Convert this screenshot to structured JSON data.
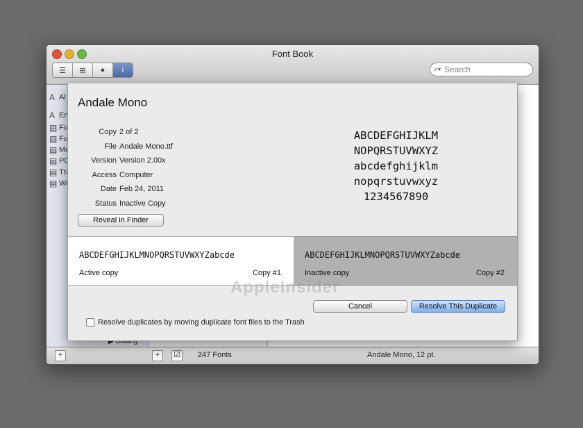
{
  "window": {
    "title": "Font Book"
  },
  "toolbar": {
    "search_placeholder": "Search"
  },
  "sidebar": {
    "items": [
      {
        "glyph": "A",
        "label": "Al"
      },
      {
        "glyph": "A",
        "label": "En"
      },
      {
        "glyph": "▤",
        "label": "Fix"
      },
      {
        "glyph": "▤",
        "label": "Fu"
      },
      {
        "glyph": "▤",
        "label": "Mo"
      },
      {
        "glyph": "▤",
        "label": "PD"
      },
      {
        "glyph": "▤",
        "label": "Tra"
      },
      {
        "glyph": "▤",
        "label": "We"
      }
    ]
  },
  "fontlist": {
    "last_item": "▶ Batang"
  },
  "watermark": "AppleInsider",
  "bottombar": {
    "font_count": "247 Fonts",
    "selection": "Andale Mono, 12 pt."
  },
  "sheet": {
    "title": "Andale Mono",
    "info": [
      {
        "key": "Copy",
        "value": "2 of 2"
      },
      {
        "key": "File",
        "value": "Andale Mono.ttf"
      },
      {
        "key": "Version",
        "value": "Version 2.00x"
      },
      {
        "key": "Access",
        "value": "Computer"
      },
      {
        "key": "Date",
        "value": "Feb 24, 2011"
      },
      {
        "key": "Status",
        "value": "Inactive Copy"
      }
    ],
    "reveal_label": "Reveal in Finder",
    "sample_lines": [
      "ABCDEFGHIJKLM",
      "NOPQRSTUVWXYZ",
      "abcdefghijklm",
      "nopqrstuvwxyz",
      "1234567890"
    ],
    "copy_a": {
      "sample": "ABCDEFGHIJKLMNOPQRSTUVWXYZabcde",
      "label": "Active copy",
      "num": "Copy #1"
    },
    "copy_b": {
      "sample": "ABCDEFGHIJKLMNOPQRSTUVWXYZabcde",
      "label": "Inactive copy",
      "num": "Copy #2"
    },
    "cancel_label": "Cancel",
    "resolve_label": "Resolve This Duplicate",
    "checkbox_label": "Resolve duplicates by moving duplicate font files to the Trash"
  }
}
